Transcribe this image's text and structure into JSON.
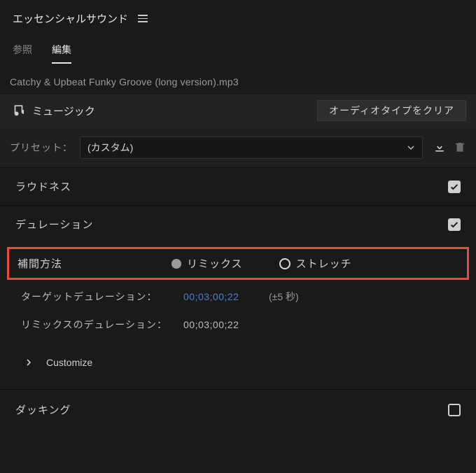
{
  "header": {
    "title": "エッセンシャルサウンド"
  },
  "tabs": {
    "browse": "参照",
    "edit": "編集"
  },
  "filename": "Catchy & Upbeat Funky Groove (long version).mp3",
  "audiotype": {
    "label": "ミュージック",
    "clear_button": "オーディオタイプをクリア"
  },
  "preset": {
    "label": "プリセット：",
    "value": "(カスタム)"
  },
  "loudness": {
    "label": "ラウドネス",
    "checked": true
  },
  "duration": {
    "label": "デュレーション",
    "checked": true
  },
  "interpolation": {
    "label": "補間方法",
    "remix": "リミックス",
    "stretch": "ストレッチ"
  },
  "target_duration": {
    "label": "ターゲットデュレーション：",
    "value": "00;03;00;22",
    "hint": "(±5 秒)"
  },
  "remix_duration": {
    "label": "リミックスのデュレーション：",
    "value": "00;03;00;22"
  },
  "customize": {
    "label": "Customize"
  },
  "ducking": {
    "label": "ダッキング",
    "checked": false
  }
}
